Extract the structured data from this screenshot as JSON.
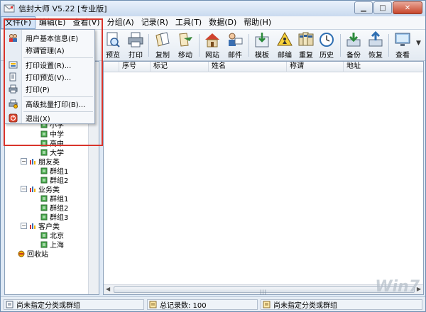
{
  "window": {
    "title": "信封大师 V5.22 [专业版]"
  },
  "menu": [
    {
      "label": "文件(F)",
      "active": true
    },
    {
      "label": "编辑(E)"
    },
    {
      "label": "查看(V)"
    },
    {
      "label": "分组(A)"
    },
    {
      "label": "记录(R)"
    },
    {
      "label": "工具(T)"
    },
    {
      "label": "数据(D)"
    },
    {
      "label": "帮助(H)"
    }
  ],
  "dropdown": [
    {
      "label": "用户基本信息(E)",
      "icon": "users-icon"
    },
    {
      "label": "称谓管理(A)",
      "icon": ""
    },
    {
      "label": "打印设置(R)...",
      "icon": "printer-settings-icon"
    },
    {
      "label": "打印预览(V)...",
      "icon": "print-preview-icon"
    },
    {
      "label": "打印(P)",
      "icon": "printer-icon"
    },
    {
      "label": "高级批量打印(B)...",
      "icon": "batch-print-icon"
    },
    {
      "label": "退出(X)",
      "icon": "exit-icon"
    }
  ],
  "toolbar": [
    {
      "label": "预览",
      "icon": "preview-icon"
    },
    {
      "label": "打印",
      "icon": "printer-icon"
    },
    {
      "label": "复制",
      "icon": "copy-icon"
    },
    {
      "label": "移动",
      "icon": "move-icon"
    },
    {
      "label": "网站",
      "icon": "website-icon"
    },
    {
      "label": "邮件",
      "icon": "mail-icon"
    },
    {
      "label": "模板",
      "icon": "template-icon"
    },
    {
      "label": "邮编",
      "icon": "postcode-icon"
    },
    {
      "label": "重复",
      "icon": "duplicate-icon"
    },
    {
      "label": "历史",
      "icon": "history-icon"
    },
    {
      "label": "备份",
      "icon": "backup-icon"
    },
    {
      "label": "恢复",
      "icon": "restore-icon"
    },
    {
      "label": "查看",
      "icon": "view-icon"
    }
  ],
  "tree": {
    "school_children": [
      "小学",
      "中学",
      "高中",
      "大学"
    ],
    "friends": {
      "label": "朋友类",
      "children": [
        "群组1",
        "群组2"
      ]
    },
    "business": {
      "label": "业务类",
      "children": [
        "群组1",
        "群组2",
        "群组3"
      ]
    },
    "customers": {
      "label": "客户类",
      "children": [
        "北京",
        "上海"
      ]
    },
    "recycle": "回收站"
  },
  "list": {
    "columns": [
      "序号",
      "标记",
      "姓名",
      "称谓",
      "地址"
    ]
  },
  "status": {
    "left": "尚未指定分类或群组",
    "middle": "总记录数: 100",
    "right": "尚未指定分类或群组"
  },
  "watermark": "Win7"
}
